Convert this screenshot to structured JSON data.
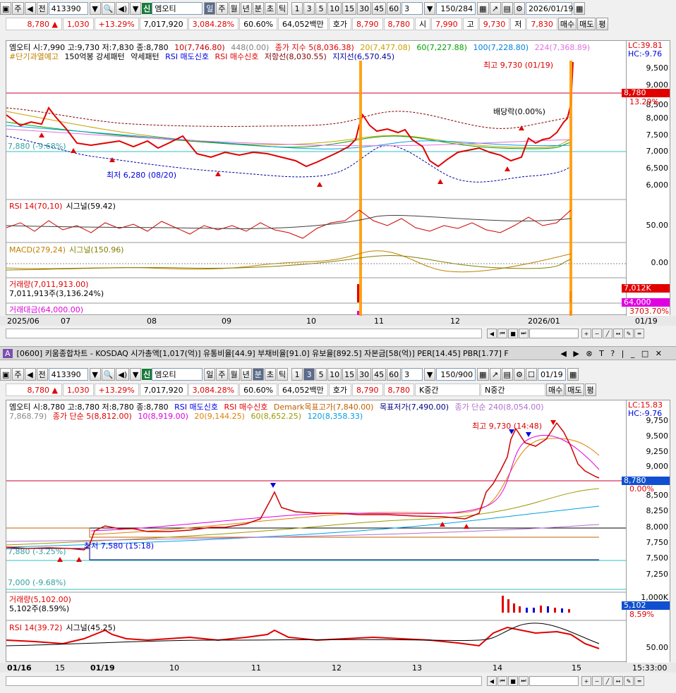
{
  "top": {
    "toolbar": {
      "tab1": "주",
      "tab2": "전",
      "code": "413390",
      "sin": "신",
      "name": "엠오티",
      "periods": [
        "일",
        "주",
        "월",
        "년",
        "분",
        "초",
        "틱"
      ],
      "nums": [
        "1",
        "3",
        "5",
        "10",
        "15",
        "30",
        "45",
        "60"
      ],
      "count": "3",
      "range": "150/284",
      "date": "2026/01/19"
    },
    "info": {
      "price": "8,780",
      "change": "1,030",
      "pct": "+13.29%",
      "volume": "7,017,920",
      "vol_pct": "3,084.28%",
      "ratio": "60.60%",
      "amount": "64,052백만",
      "hoga_label": "호가",
      "hoga1": "8,790",
      "hoga2": "8,780",
      "si_label": "시",
      "si": "7,990",
      "go_label": "고",
      "go": "9,730",
      "jeo_label": "저",
      "jeo": "7,830",
      "buy": "매수",
      "sell": "매도",
      "pyeong": "평"
    },
    "legend1": "엠오티 시:7,990 고:9,730 저:7,830 종:8,780",
    "ma_items": [
      "10(7,746.80)",
      "448(0.00)",
      "종가 지수 5(8,036.38)",
      "20(7,477.08)",
      "60(7,227.88)",
      "100(7,228.80)",
      "224(7,368.89)"
    ],
    "legend2": [
      "#단기과열예고",
      "150억봉 강세패턴",
      "약세패턴",
      "RSI 매도신호",
      "RSI 매수신호",
      "저항선(8,030.55)",
      "지지선(6,570.45)"
    ],
    "lc": "LC:39.81",
    "hc": "HC:-9.76",
    "y_labels": [
      "9,500",
      "9,000",
      "8,500",
      "8,000",
      "7,500",
      "7,000",
      "6,500",
      "6,000"
    ],
    "price_tag": "8,780",
    "pct_tag": "13.29%",
    "high_note": "최고 9,730 (01/19)",
    "low_note": "최저 6,280 (08/20)",
    "div_note": "배당락(0.00%)",
    "base_note": "7,880 (-9.68%)",
    "rsi_legend": "RSI 14(70,10)",
    "rsi_signal": "시그널(59.42)",
    "rsi_y": "50.00",
    "macd_legend": "MACD(279,24)",
    "macd_signal": "시그널(150.96)",
    "macd_y": "0.00",
    "vol_legend": "거래량(7,011,913.00)",
    "vol_sub": "7,011,913주(3,136.24%)",
    "vol_tag": "7,012K",
    "vol_tag2": "3136.24%",
    "amt_legend": "거래대금(64,000.00)",
    "amt_tag": "64,000",
    "amt_tag2": "3703.70%",
    "x_labels": [
      "2025/06",
      "07",
      "08",
      "09",
      "10",
      "11",
      "12",
      "2026/01"
    ],
    "x_right": "01/19"
  },
  "bot": {
    "titlebar": "[0600] 키움종합차트 - KOSDAQ 시가총액[1,017(억)] 유통비율[44.9] 부채비율[91.0] 유보율[892.5] 자본금[58(억)] PER[14.45] PBR[1.77] F",
    "toolbar": {
      "tab1": "주",
      "tab2": "전",
      "code": "413390",
      "sin": "신",
      "name": "엠오티",
      "periods": [
        "일",
        "주",
        "월",
        "년",
        "분",
        "초",
        "틱"
      ],
      "nums": [
        "1",
        "3",
        "5",
        "10",
        "15",
        "30",
        "45",
        "60"
      ],
      "count": "3",
      "range": "150/900",
      "date": "01/19"
    },
    "info": {
      "price": "8,780",
      "change": "1,030",
      "pct": "+13.29%",
      "volume": "7,017,920",
      "vol_pct": "3,084.28%",
      "ratio": "60.60%",
      "amount": "64,052백만",
      "hoga_label": "호가",
      "hoga1": "8,790",
      "hoga2": "8,780",
      "k": "K중간",
      "n": "N중간",
      "buy": "매수",
      "sell": "매도",
      "pyeong": "평"
    },
    "legend1": [
      "엠오티 시:8,780 고:8,780 저:8,780 종:8,780",
      "RSI 매도신호",
      "RSI 매수신호",
      "Demark목표고가(7,840.00)",
      "목표저가(7,490.00)",
      "종가 단순 240(8,054.00)"
    ],
    "legend2": [
      "7,868.79)",
      "종가 단순 5(8,812.00)",
      "10(8,919.00)",
      "20(9,144.25)",
      "60(8,652.25)",
      "120(8,358.33)"
    ],
    "lc": "LC:15.83",
    "hc": "HC:-9.76",
    "y_labels": [
      "9,750",
      "9,500",
      "9,250",
      "9,000",
      "8,750",
      "8,500",
      "8,250",
      "8,000",
      "7,750",
      "7,500",
      "7,250"
    ],
    "price_tag": "8,780",
    "pct_tag": "0.00%",
    "high_note": "최고 9,730 (14:48)",
    "low_note": "최저 7,580 (15:18)",
    "base1": "7,880 (-3.25%)",
    "base2": "7,000 (-9.68%)",
    "vol_legend": "거래량(5,102.00)",
    "vol_sub": "5,102주(8.59%)",
    "vol_y": "1,000K",
    "vol_tag": "5,102",
    "vol_tag2": "8.59%",
    "rsi_legend": "RSI 14(39.72)",
    "rsi_signal": "시그널(45.25)",
    "rsi_y": "50.00",
    "x_labels": [
      "01/16",
      "15",
      "01/19",
      "10",
      "11",
      "12",
      "13",
      "14",
      "15"
    ],
    "x_right": "15:33:00"
  }
}
